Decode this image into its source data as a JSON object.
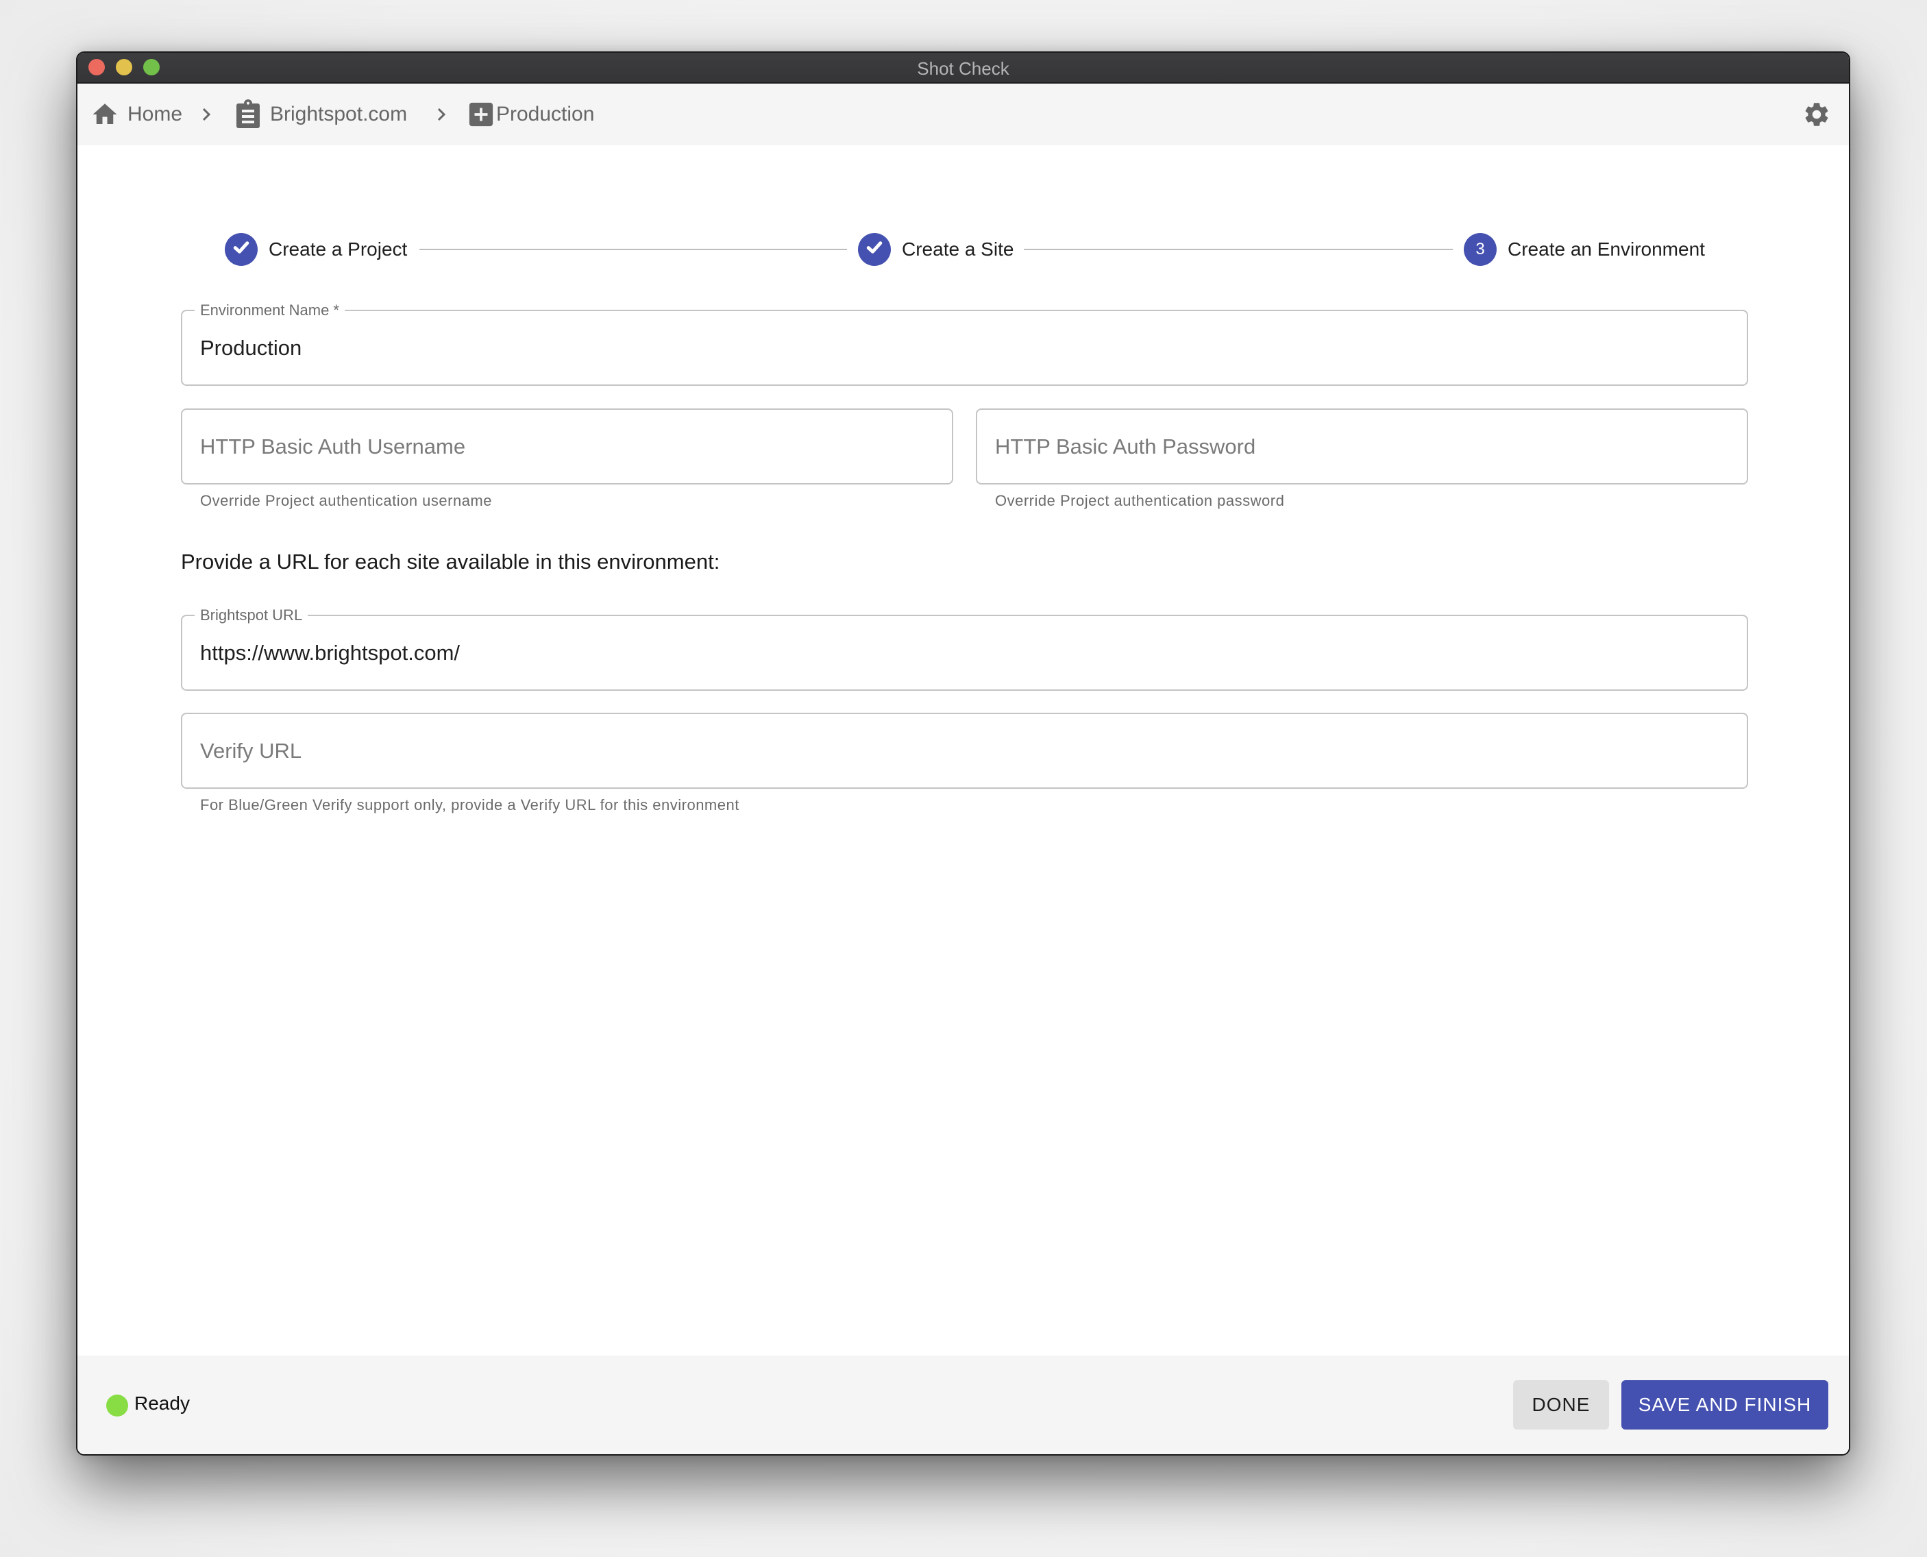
{
  "window": {
    "title": "Shot Check"
  },
  "breadcrumb": {
    "items": [
      {
        "label": "Home",
        "icon": "home-icon"
      },
      {
        "label": "Brightspot.com",
        "icon": "clipboard-icon"
      },
      {
        "label": "Production",
        "icon": "plus-box-icon"
      }
    ],
    "separator_icon": "chevron-right-icon",
    "settings_icon": "gear-icon"
  },
  "stepper": {
    "steps": [
      {
        "label": "Create a Project",
        "state": "completed",
        "number": "1"
      },
      {
        "label": "Create a Site",
        "state": "completed",
        "number": "2"
      },
      {
        "label": "Create an Environment",
        "state": "active",
        "number": "3"
      }
    ]
  },
  "form": {
    "environment_name": {
      "label": "Environment Name *",
      "value": "Production"
    },
    "auth_username": {
      "placeholder": "HTTP Basic Auth Username",
      "value": "",
      "helper": "Override Project authentication username"
    },
    "auth_password": {
      "placeholder": "HTTP Basic Auth Password",
      "value": "",
      "helper": "Override Project authentication password"
    },
    "url_section_heading": "Provide a URL for each site available in this environment:",
    "site_url": {
      "label": "Brightspot URL",
      "value": "https://www.brightspot.com/"
    },
    "verify_url": {
      "placeholder": "Verify URL",
      "value": "",
      "helper": "For Blue/Green Verify support only, provide a Verify URL for this environment"
    }
  },
  "footer": {
    "status": "Ready",
    "status_color": "#88dd44",
    "done_label": "DONE",
    "save_label": "SAVE AND FINISH"
  },
  "colors": {
    "accent": "#4551b0",
    "titlebar": "#3a3a3d",
    "icon_gray": "#666666"
  }
}
